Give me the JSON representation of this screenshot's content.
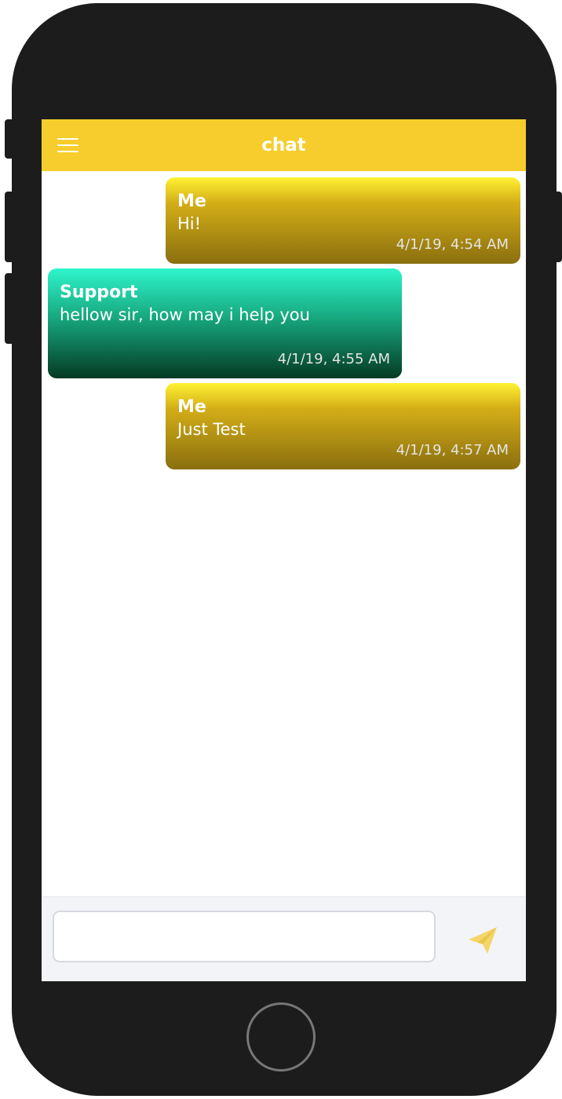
{
  "header": {
    "title": "chat",
    "menu_icon": "hamburger-menu-icon"
  },
  "messages": [
    {
      "sender": "Me",
      "text": "Hi!",
      "time": "4/1/19, 4:54 AM",
      "type": "me"
    },
    {
      "sender": "Support",
      "text": "hellow sir, how may i help you",
      "time": "4/1/19, 4:55 AM",
      "type": "support"
    },
    {
      "sender": "Me",
      "text": "Just Test",
      "time": "4/1/19, 4:57 AM",
      "type": "me"
    }
  ],
  "composer": {
    "input_value": "",
    "placeholder": "",
    "send_icon": "paper-plane-send-icon"
  },
  "colors": {
    "header_bg": "#f6cd2c",
    "me_bubble_top": "#fff133",
    "me_bubble_bottom": "#8a6f0f",
    "support_bubble_top": "#2ff5cb",
    "support_bubble_bottom": "#053a24",
    "send_icon": "#f4d668",
    "device_frame": "#1c1c1c"
  }
}
